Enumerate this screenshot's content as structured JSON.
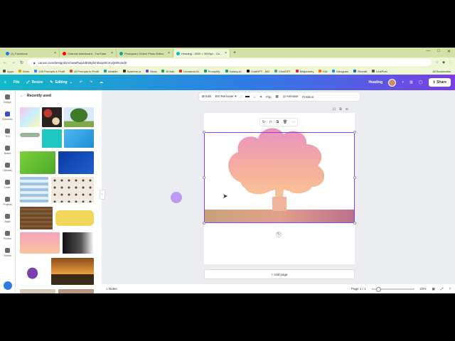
{
  "browser": {
    "tabs": [
      {
        "label": "(1) Facebook",
        "icon_color": "#1877f2"
      },
      {
        "label": "Channel dashboard - YouTube",
        "icon_color": "#ff0000"
      },
      {
        "label": "Photopea | Online Photo Editor",
        "icon_color": "#18a497"
      },
      {
        "label": "Heading - 3000 × 3000px - Ca",
        "icon_color": "#00c4cc",
        "active": true
      }
    ],
    "url": "canva.com/design/DAGwwPwp4dE/BybmBxqs0CKvQ6Rn/edit",
    "bookmarks": [
      "Apps",
      "Work",
      "100 Prompts & Profit",
      "AI Prompts to Profit",
      "Airtable",
      "Systeme.io",
      "Mura",
      "AI Ads",
      "Leonardo.Ai",
      "Promptify",
      "Galaxy.AI",
      "ChatGPT - MO",
      "ChatGPT",
      "Midjourney",
      "KM",
      "Ideogram",
      "Recraft",
      "LinkPost"
    ],
    "bookmarks_right": "All Bookmarks"
  },
  "canva": {
    "menu": {
      "file": "File",
      "resize": "Resize",
      "editing": "Editing"
    },
    "design_title": "Heading",
    "share": "Share",
    "rail": [
      "Design",
      "Elements",
      "Text",
      "Brand",
      "Uploads",
      "Draw",
      "Projects",
      "Apps",
      "Photos",
      "Videos"
    ],
    "active_rail": "Elements",
    "panel": {
      "back": "←",
      "title": "Recently used"
    },
    "toolbar": {
      "edit": "Edit",
      "bg_remover": "BG Remover",
      "flip": "Flip",
      "animate": "Animate",
      "position": "Position"
    },
    "add_page": "+ Add page",
    "notes": "Notes",
    "page_counter": "Page 1 / 1",
    "zoom": "23%"
  },
  "colors": {
    "accent": "#8b3dff",
    "canva_gradient_start": "#12b9c7",
    "canva_gradient_end": "#7b3fe4"
  }
}
